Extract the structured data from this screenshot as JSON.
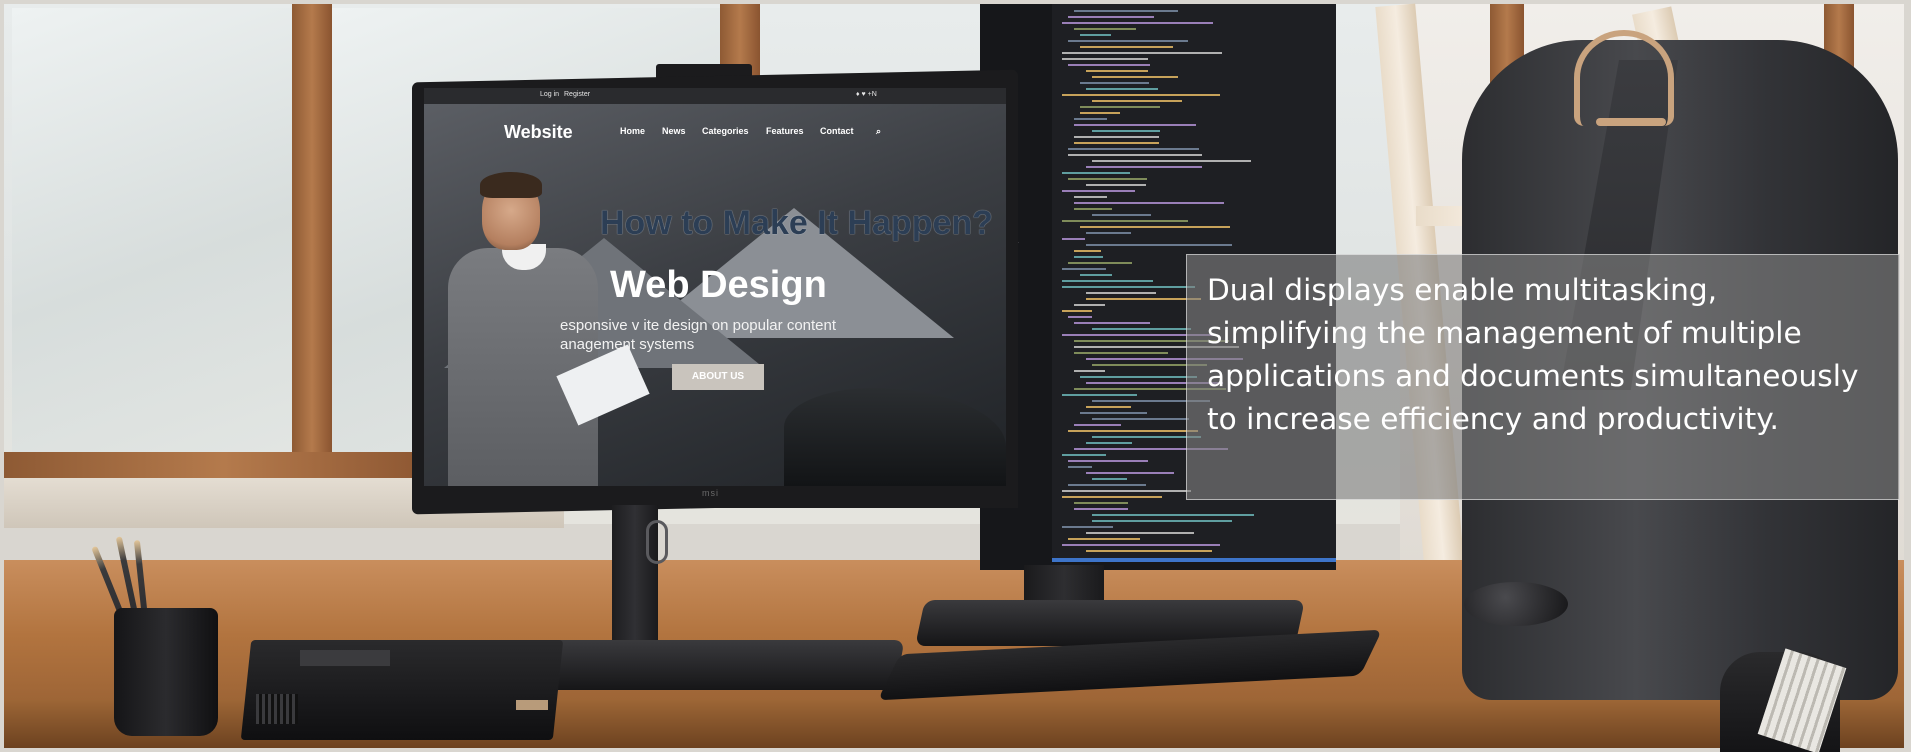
{
  "caption": {
    "lines": [
      "Dual displays enable multitasking,",
      "simplifying the management of multiple",
      "applications and documents simultaneously",
      "to increase efficiency and productivity."
    ]
  },
  "left_screen": {
    "top_links": [
      "Log in",
      "Register"
    ],
    "top_icons": "♦ ♥ +N",
    "logo": "Website",
    "nav": [
      "Home",
      "News",
      "Categories",
      "Features",
      "Contact"
    ],
    "headline": "How to Make It Happen?",
    "subheadline": "Web Design",
    "description": "esponsive v     ite design on popular content anagement systems",
    "button": "ABOUT US"
  },
  "monitor_brand": "msi",
  "colors": {
    "caption_bg": "#808080",
    "code_accent": "#3d74c9",
    "desk": "#b2743f"
  }
}
